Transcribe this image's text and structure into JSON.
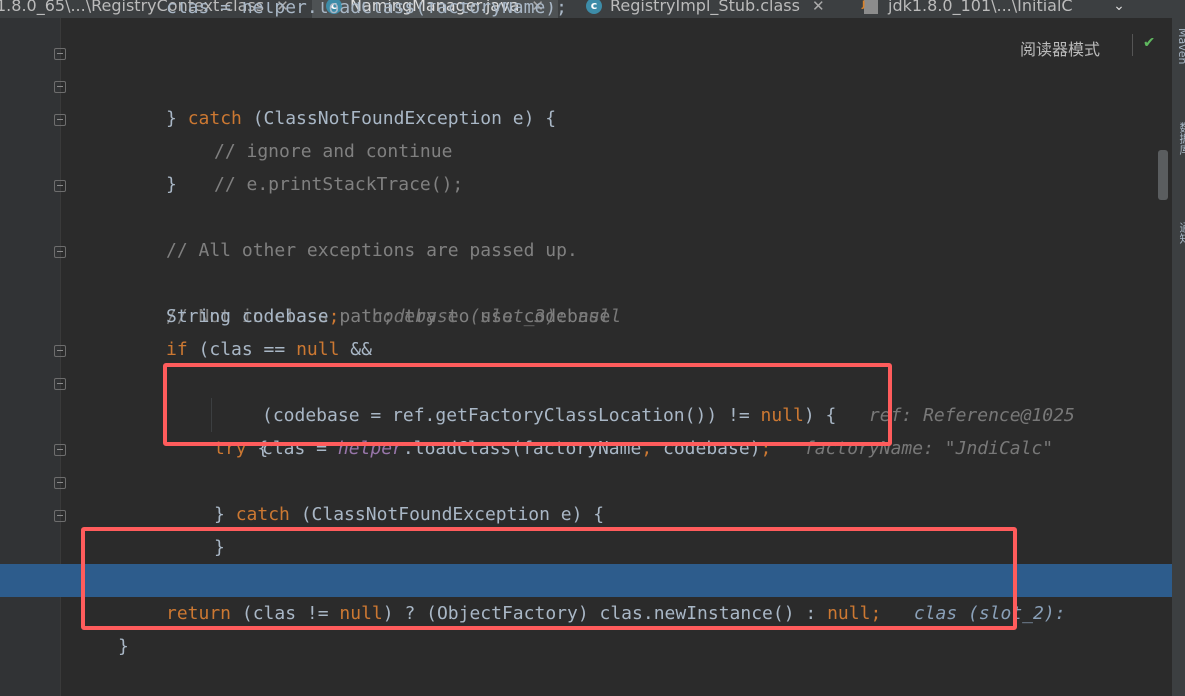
{
  "tabs": [
    {
      "label": "1.8.0_65\\...\\RegistryContext.class",
      "icon": "class-icon",
      "active": false
    },
    {
      "label": "NamingManager.java",
      "icon": "class-icon",
      "active": true
    },
    {
      "label": "RegistryImpl_Stub.class",
      "icon": "class-icon",
      "active": false
    },
    {
      "label": "jdk1.8.0_101\\...\\InitialC",
      "icon": "jar-icon",
      "active": false
    }
  ],
  "tab_chevron": "⌄",
  "reader_mode": "阅读器模式",
  "side_labels": [
    "Maven",
    "数据库",
    "通知"
  ],
  "code": {
    "partial_top": "clas = helper.loadClass(factoryName);",
    "l1": [
      "} ",
      "catch",
      " (ClassNotFoundException e) {"
    ],
    "l2": "// ignore and continue",
    "l3": "// e.printStackTrace();",
    "l4": "}",
    "l5": "// All other exceptions are passed up.",
    "l7": "// Not in class path; try to use codebase",
    "l8": [
      "String codebase",
      ";",
      "codebase (slot_3): null"
    ],
    "l9": [
      "if",
      " (clas == ",
      "null",
      " &&"
    ],
    "l10": [
      "(codebase = ref.getFactoryClassLocation()) != ",
      "null",
      ") {",
      "ref: Reference@1025"
    ],
    "l11": [
      "try",
      " {"
    ],
    "l12": [
      "clas = ",
      "helper",
      ".loadClass(factoryName",
      ",",
      " codebase)",
      ";",
      "factoryName: \"JndiCalc\""
    ],
    "l13": [
      "} ",
      "catch",
      " (ClassNotFoundException e) {"
    ],
    "l14": "}",
    "l15": "}",
    "l17": [
      "return",
      " (clas != ",
      "null",
      ") ? (ObjectFactory) clas.newInstance() : ",
      "null",
      ";",
      "clas (slot_2): "
    ],
    "l18": "}"
  },
  "colors": {
    "keyword": "#cc7832",
    "comment": "#808080",
    "highlight": "#2d5c8c",
    "annotation": "#ff5c5c"
  }
}
